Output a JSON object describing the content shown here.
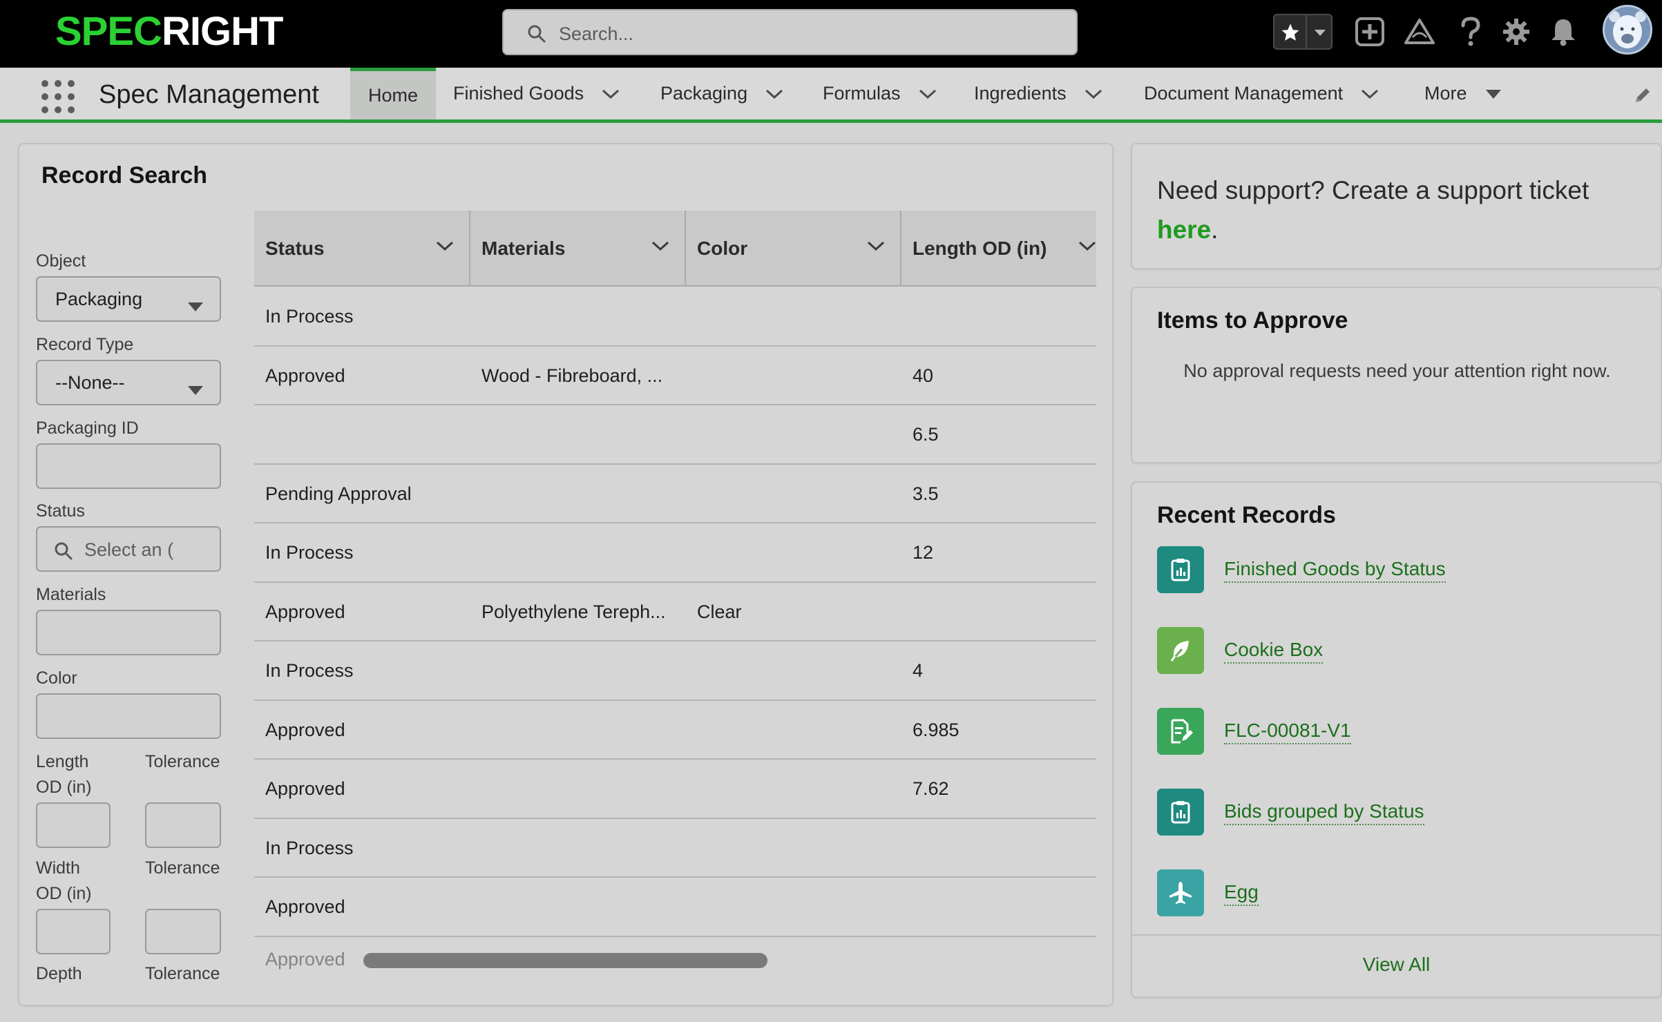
{
  "brand": {
    "logo_part1": "SPEC",
    "logo_part2": "RIGHT"
  },
  "global_search": {
    "placeholder": "Search..."
  },
  "nav": {
    "app_name": "Spec Management",
    "tabs": [
      {
        "label": "Home",
        "has_menu": false
      },
      {
        "label": "Finished Goods",
        "has_menu": true
      },
      {
        "label": "Packaging",
        "has_menu": true
      },
      {
        "label": "Formulas",
        "has_menu": true
      },
      {
        "label": "Ingredients",
        "has_menu": true
      },
      {
        "label": "Document Management",
        "has_menu": true
      },
      {
        "label": "More",
        "has_menu": true
      }
    ]
  },
  "record_search": {
    "title": "Record Search",
    "filters": {
      "object_label": "Object",
      "object_value": "Packaging",
      "record_type_label": "Record Type",
      "record_type_value": "--None--",
      "packaging_id_label": "Packaging ID",
      "status_label": "Status",
      "status_placeholder": "Select an (",
      "materials_label": "Materials",
      "color_label": "Color",
      "length_label": "Length OD (in)",
      "width_label": "Width OD (in)",
      "depth_label": "Depth",
      "tolerance_label": "Tolerance"
    },
    "table": {
      "columns": [
        "Status",
        "Materials",
        "Color",
        "Length OD (in)"
      ],
      "rows": [
        [
          "In Process",
          "",
          "",
          ""
        ],
        [
          "Approved",
          "Wood - Fibreboard, ...",
          "",
          "40"
        ],
        [
          "",
          "",
          "",
          "6.5"
        ],
        [
          "Pending Approval",
          "",
          "",
          "3.5"
        ],
        [
          "In Process",
          "",
          "",
          "12"
        ],
        [
          "Approved",
          "Polyethylene Tereph...",
          "Clear",
          ""
        ],
        [
          "In Process",
          "",
          "",
          "4"
        ],
        [
          "Approved",
          "",
          "",
          "6.985"
        ],
        [
          "Approved",
          "",
          "",
          "7.62"
        ],
        [
          "In Process",
          "",
          "",
          ""
        ],
        [
          "Approved",
          "",
          "",
          ""
        ],
        [
          "Approved",
          "",
          "",
          ""
        ]
      ]
    }
  },
  "support": {
    "text": "Need support? Create a support ticket",
    "link": "here",
    "suffix": "."
  },
  "approvals": {
    "title": "Items to Approve",
    "message": "No approval requests need your attention right now."
  },
  "recent": {
    "title": "Recent Records",
    "items": [
      {
        "label": "Finished Goods by Status",
        "icon": "report-icon",
        "color": "#1e8a80"
      },
      {
        "label": "Cookie Box",
        "icon": "leaf-icon",
        "color": "#6ab04c"
      },
      {
        "label": "FLC-00081-V1",
        "icon": "document-edit-icon",
        "color": "#3aa65a"
      },
      {
        "label": "Bids grouped by Status",
        "icon": "report-icon",
        "color": "#1e8a80"
      },
      {
        "label": "Egg",
        "icon": "plane-icon",
        "color": "#3aa3a3"
      }
    ],
    "view_all": "View All"
  },
  "colors": {
    "brand_green": "#2bd133",
    "accent_green": "#2a9d3c",
    "link_green": "#1b6f1b"
  }
}
